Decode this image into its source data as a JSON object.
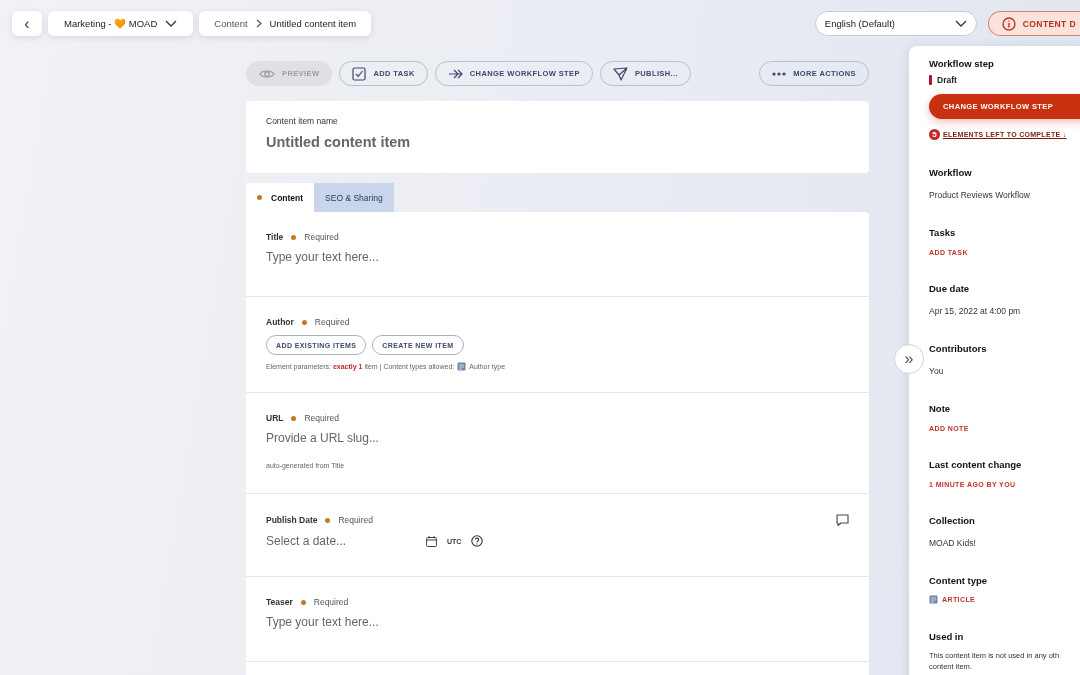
{
  "topbar": {
    "back_button": "‹",
    "project": "Marketing - 🧡 MOAD",
    "breadcrumb": [
      "Content",
      "Untitled content item"
    ],
    "language": "English (Default)",
    "status_button": "CONTENT D"
  },
  "toolbar": [
    {
      "kind": "eye",
      "label": "PREVIEW",
      "disabled": true
    },
    {
      "kind": "check",
      "label": "ADD TASK",
      "disabled": false
    },
    {
      "kind": "arrow",
      "label": "CHANGE WORKFLOW STEP",
      "disabled": false
    },
    {
      "kind": "plane",
      "label": "PUBLISH...",
      "disabled": false
    },
    {
      "kind": "dots",
      "label": "MORE ACTIONS",
      "disabled": false
    }
  ],
  "name_card": {
    "label": "Content item name",
    "value": "Untitled content item"
  },
  "tabs": [
    {
      "label": "Content",
      "selected": true,
      "incomplete": true
    },
    {
      "label": "SEO & Sharing",
      "selected": false,
      "incomplete": false
    }
  ],
  "fields": [
    {
      "kind": "text",
      "label": "Title",
      "required": "Required",
      "placeholder": "Type your text here..."
    },
    {
      "kind": "linked",
      "label": "Author",
      "required": "Required",
      "buttons": [
        "ADD EXISTING ITEMS",
        "CREATE NEW ITEM"
      ],
      "hint": "Element parameters: **exactly 1** item | Content types allowed: ",
      "type_name": "Author type"
    },
    {
      "kind": "slug",
      "label": "URL",
      "required": "Required",
      "placeholder": "Provide a URL slug...",
      "hint": "auto-generated from Title"
    },
    {
      "kind": "date",
      "label": "Publish Date",
      "required": "Required",
      "placeholder": "Select a date...",
      "timezone": "UTC"
    },
    {
      "kind": "text",
      "label": "Teaser",
      "required": "Required",
      "placeholder": "Type your text here..."
    }
  ],
  "panel": {
    "workflow_step": {
      "heading": "Workflow step",
      "step": "Draft",
      "color": "#b3122a",
      "button": "CHANGE WORKFLOW STEP",
      "left_count": "5",
      "left_link": "ELEMENTS LEFT TO COMPLETE ↓"
    },
    "sections": [
      {
        "kind": "text",
        "heading": "Workflow",
        "value": "Product Reviews Workflow"
      },
      {
        "kind": "link",
        "heading": "Tasks",
        "value": "ADD TASK"
      },
      {
        "kind": "text",
        "heading": "Due date",
        "value": "Apr 15, 2022 at 4:00 pm"
      },
      {
        "kind": "text",
        "heading": "Contributors",
        "value": "You"
      },
      {
        "kind": "link",
        "heading": "Note",
        "value": "ADD NOTE"
      },
      {
        "kind": "link",
        "heading": "Last content change",
        "value": "1 MINUTE AGO BY YOU"
      },
      {
        "kind": "text",
        "heading": "Collection",
        "value": "MOAD Kids!"
      },
      {
        "kind": "type",
        "heading": "Content type",
        "value": "ARTICLE"
      },
      {
        "kind": "note",
        "heading": "Used in",
        "lines": [
          "This content item is not used in any oth",
          "content item."
        ]
      }
    ]
  },
  "expand_button": "»"
}
